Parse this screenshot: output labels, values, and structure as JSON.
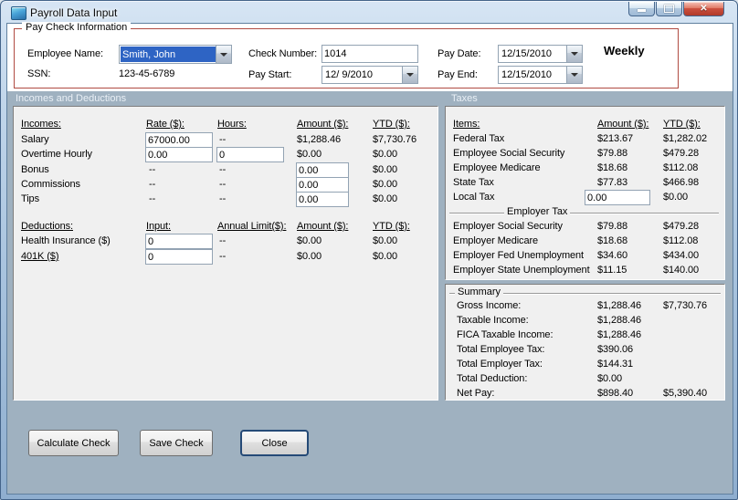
{
  "colors": {
    "selection_highlight": "#2E64C4",
    "section_background": "#9FB1C0",
    "panel_background": "#F0F0F0",
    "group_border": "#B04B42",
    "close_button_red": "#C0392B"
  },
  "icons": {
    "close": "✕",
    "dropdown": "▼"
  },
  "window": {
    "title": "Payroll Data Input"
  },
  "paycheck": {
    "group_title": "Pay Check Information",
    "employee_label": "Employee Name:",
    "employee_value": "Smith, John",
    "ssn_label": "SSN:",
    "ssn_value": "123-45-6789",
    "check_label": "Check Number:",
    "check_value": "1014",
    "pay_start_label": "Pay Start:",
    "pay_start_value": "12/ 9/2010",
    "pay_date_label": "Pay Date:",
    "pay_date_value": "12/15/2010",
    "pay_end_label": "Pay End:",
    "pay_end_value": "12/15/2010",
    "frequency": "Weekly"
  },
  "sections": {
    "incomes_deductions": "Incomes and Deductions",
    "taxes": "Taxes"
  },
  "incomes": {
    "headers": {
      "name": "Incomes:",
      "rate": "Rate ($):",
      "hours": "Hours:",
      "amount": "Amount ($):",
      "ytd": "YTD ($):"
    },
    "salary": {
      "label": "Salary",
      "rate": "67000.00",
      "hours": "--",
      "amount": "$1,288.46",
      "ytd": "$7,730.76"
    },
    "overtime": {
      "label": "Overtime Hourly",
      "rate": "0.00",
      "hours": "0",
      "amount": "$0.00",
      "ytd": "$0.00"
    },
    "bonus": {
      "label": "Bonus",
      "rate": "--",
      "hours": "--",
      "amount": "0.00",
      "ytd": "$0.00"
    },
    "commissions": {
      "label": "Commissions",
      "rate": "--",
      "hours": "--",
      "amount": "0.00",
      "ytd": "$0.00"
    },
    "tips": {
      "label": "Tips",
      "rate": "--",
      "hours": "--",
      "amount": "0.00",
      "ytd": "$0.00"
    }
  },
  "deductions": {
    "headers": {
      "name": "Deductions:",
      "input": "Input:",
      "limit": "Annual Limit($):",
      "amount": "Amount ($):",
      "ytd": "YTD ($):"
    },
    "health": {
      "label": "Health Insurance  ($)",
      "input": "0",
      "limit": "--",
      "amount": "$0.00",
      "ytd": "$0.00"
    },
    "k401": {
      "label": "401K  ($)",
      "input": "0",
      "limit": "--",
      "amount": "$0.00",
      "ytd": "$0.00"
    }
  },
  "taxes": {
    "headers": {
      "items": "Items:",
      "amount": "Amount ($):",
      "ytd": "YTD ($):"
    },
    "federal": {
      "label": "Federal Tax",
      "amount": "$213.67",
      "ytd": "$1,282.02"
    },
    "employee_ss": {
      "label": "Employee Social Security",
      "amount": "$79.88",
      "ytd": "$479.28"
    },
    "employee_medicare": {
      "label": "Employee Medicare",
      "amount": "$18.68",
      "ytd": "$112.08"
    },
    "state": {
      "label": "State Tax",
      "amount": "$77.83",
      "ytd": "$466.98"
    },
    "local": {
      "label": "Local Tax",
      "amount": "0.00",
      "ytd": "$0.00"
    },
    "employer_group": "Employer Tax",
    "employer_ss": {
      "label": "Employer Social Security",
      "amount": "$79.88",
      "ytd": "$479.28"
    },
    "employer_medicare": {
      "label": "Employer Medicare",
      "amount": "$18.68",
      "ytd": "$112.08"
    },
    "employer_fed_unemployment": {
      "label": "Employer Fed Unemployment",
      "amount": "$34.60",
      "ytd": "$434.00"
    },
    "employer_state_unemployment": {
      "label": "Employer State Unemployment",
      "amount": "$11.15",
      "ytd": "$140.00"
    }
  },
  "summary": {
    "group_title": "Summary",
    "gross": {
      "label": "Gross Income:",
      "amount": "$1,288.46",
      "ytd": "$7,730.76"
    },
    "taxable": {
      "label": "Taxable Income:",
      "amount": "$1,288.46"
    },
    "fica": {
      "label": "FICA Taxable Income:",
      "amount": "$1,288.46"
    },
    "total_employee_tax": {
      "label": "Total Employee Tax:",
      "amount": "$390.06"
    },
    "total_employer_tax": {
      "label": "Total Employer Tax:",
      "amount": "$144.31"
    },
    "total_deduction": {
      "label": "Total Deduction:",
      "amount": "$0.00"
    },
    "net_pay": {
      "label": "Net Pay:",
      "amount": "$898.40",
      "ytd": "$5,390.40"
    }
  },
  "buttons": {
    "calculate": "Calculate Check",
    "save": "Save Check",
    "close": "Close"
  }
}
